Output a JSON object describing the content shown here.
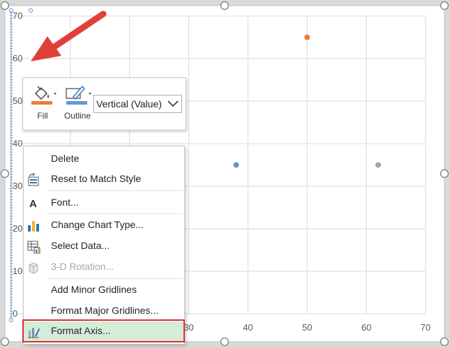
{
  "chart_data": {
    "type": "scatter",
    "title": "",
    "xlabel": "",
    "ylabel": "",
    "xlim": [
      0,
      70
    ],
    "ylim": [
      0,
      70
    ],
    "x_ticks": [
      "30",
      "40",
      "50",
      "60",
      "70"
    ],
    "y_ticks": [
      "0",
      "10",
      "20",
      "30",
      "40",
      "50",
      "60",
      "70"
    ],
    "grid": true,
    "points": [
      {
        "x": 38,
        "y": 35,
        "color": "#5b9bd5"
      },
      {
        "x": 50,
        "y": 65,
        "color": "#ed7d31"
      },
      {
        "x": 62,
        "y": 35,
        "color": "#a5a5a5"
      }
    ]
  },
  "toolbar": {
    "fill_label": "Fill",
    "outline_label": "Outline",
    "element_select_value": "Vertical (Value)",
    "fill_color": "#ed7d31",
    "outline_color": "#5b9bd5"
  },
  "context_menu": {
    "items": [
      {
        "label": "Delete",
        "icon": "none",
        "disabled": false
      },
      {
        "label": "Reset to Match Style",
        "icon": "reset-style-icon",
        "disabled": false
      },
      {
        "label": "Font...",
        "icon": "font-icon",
        "disabled": false
      },
      {
        "label": "Change Chart Type...",
        "icon": "chart-type-icon",
        "disabled": false
      },
      {
        "label": "Select Data...",
        "icon": "select-data-icon",
        "disabled": false
      },
      {
        "label": "3-D Rotation...",
        "icon": "rotation-3d-icon",
        "disabled": true
      },
      {
        "label": "Add Minor Gridlines",
        "icon": "none",
        "disabled": false
      },
      {
        "label": "Format Major Gridlines...",
        "icon": "none",
        "disabled": false
      },
      {
        "label": "Format Axis...",
        "icon": "format-axis-icon",
        "disabled": false,
        "highlighted": true
      }
    ]
  },
  "annotation": {
    "arrow_color": "#e0403a",
    "highlight_color": "#d5322f"
  }
}
